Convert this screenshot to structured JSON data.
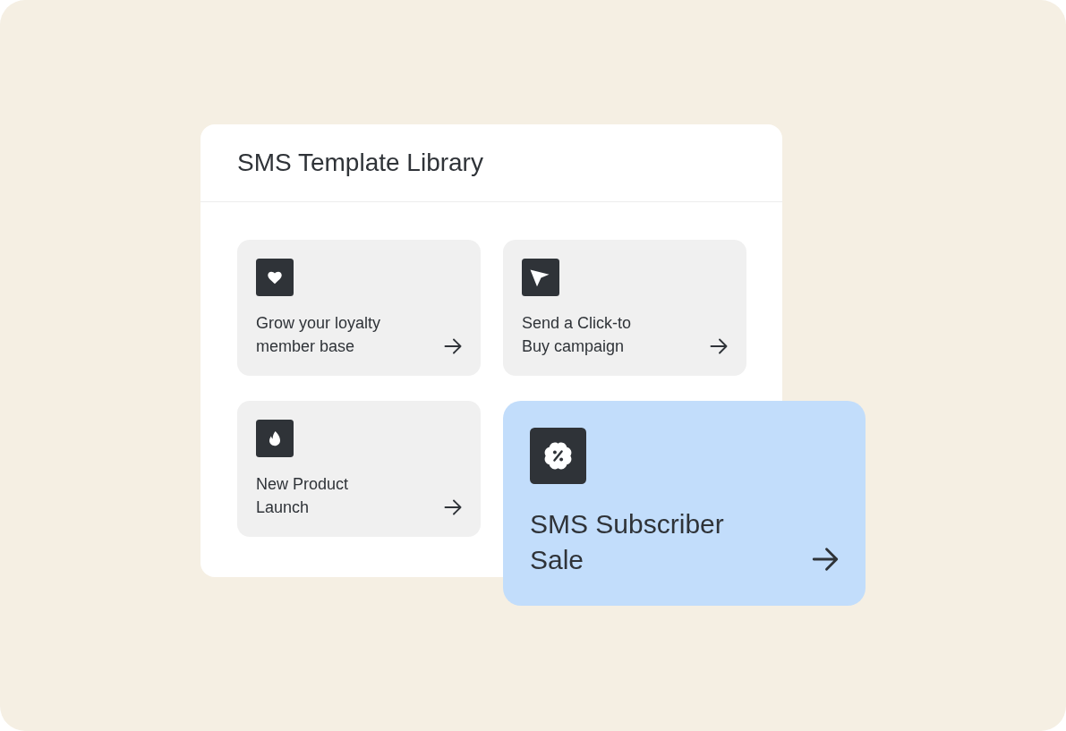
{
  "panel": {
    "title": "SMS Template Library"
  },
  "templates": [
    {
      "label": "Grow your loyalty\nmember base",
      "selected": false
    },
    {
      "label": "Send a Click-to\nBuy campaign",
      "selected": false
    },
    {
      "label": "New Product\nLaunch",
      "selected": false
    },
    {
      "label": "SMS Subscriber\nSale",
      "selected": true
    }
  ]
}
